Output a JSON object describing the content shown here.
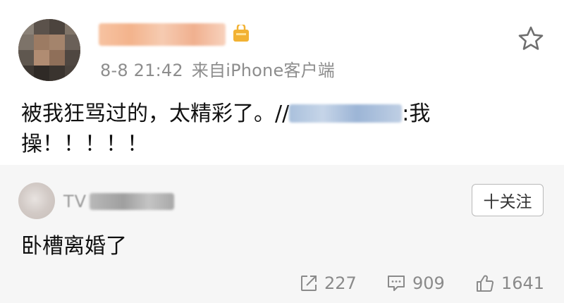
{
  "post": {
    "timestamp": "8-8 21:42",
    "source": "来自iPhone客户端",
    "text_before": "被我狂骂过的，太精彩了。//",
    "text_after": ":我",
    "text_line2": "操！！！！！"
  },
  "repost": {
    "user_prefix": "TV",
    "follow_label": "十关注",
    "text": "卧槽离婚了"
  },
  "actions": {
    "share_count": "227",
    "comment_count": "909",
    "like_count": "1641"
  },
  "colors": {
    "repost_background": "#f6f6f6",
    "meta_text": "#8d8d8d",
    "mention_blue": "#a9c0dc"
  },
  "icons": {
    "follow": "star-icon",
    "badge": "vip-badge-icon",
    "share": "share-icon",
    "comment": "comment-icon",
    "like": "thumbs-up-icon"
  }
}
